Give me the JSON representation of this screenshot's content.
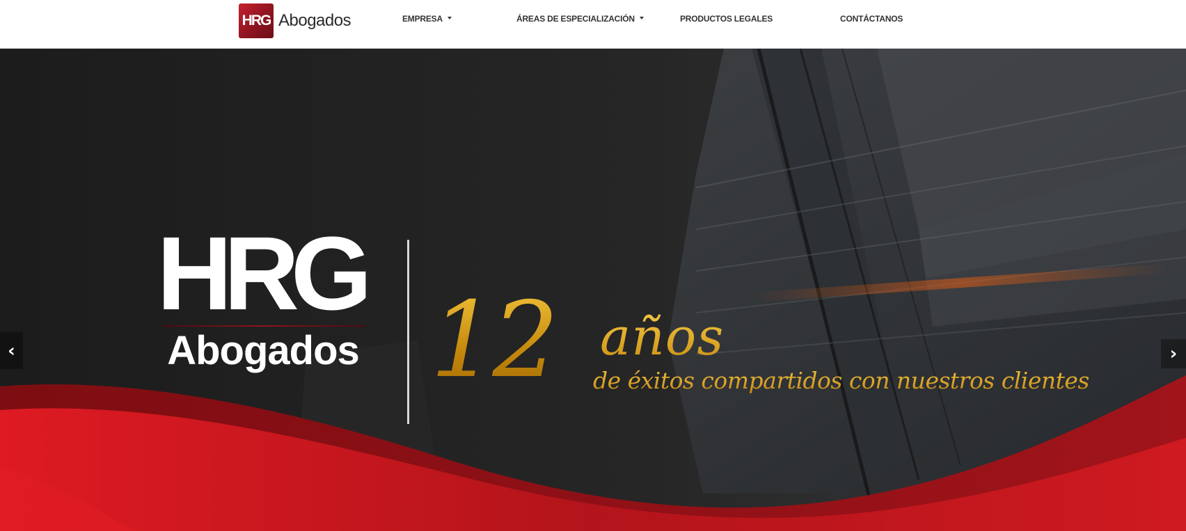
{
  "brand": {
    "logo_text": "HRG",
    "name": "Abogados"
  },
  "nav": {
    "items": [
      {
        "label": "EMPRESA",
        "has_dropdown": true
      },
      {
        "label": "ÁREAS DE ESPECIALIZACIÓN",
        "has_dropdown": true
      },
      {
        "label": "PRODUCTOS LEGALES",
        "has_dropdown": false
      },
      {
        "label": "CONTÁCTANOS",
        "has_dropdown": false
      }
    ]
  },
  "hero": {
    "logo_hrg": "HRG",
    "logo_abogados": "Abogados",
    "number": "12",
    "anos": "años",
    "tagline": "de éxitos compartidos con nuestros clientes",
    "prev_arrow": "‹",
    "next_arrow": "›"
  },
  "colors": {
    "brand_red": "#8e1420",
    "accent_red": "#d71920",
    "gold": "#d09a12",
    "hero_dark": "#1f1f1f"
  }
}
